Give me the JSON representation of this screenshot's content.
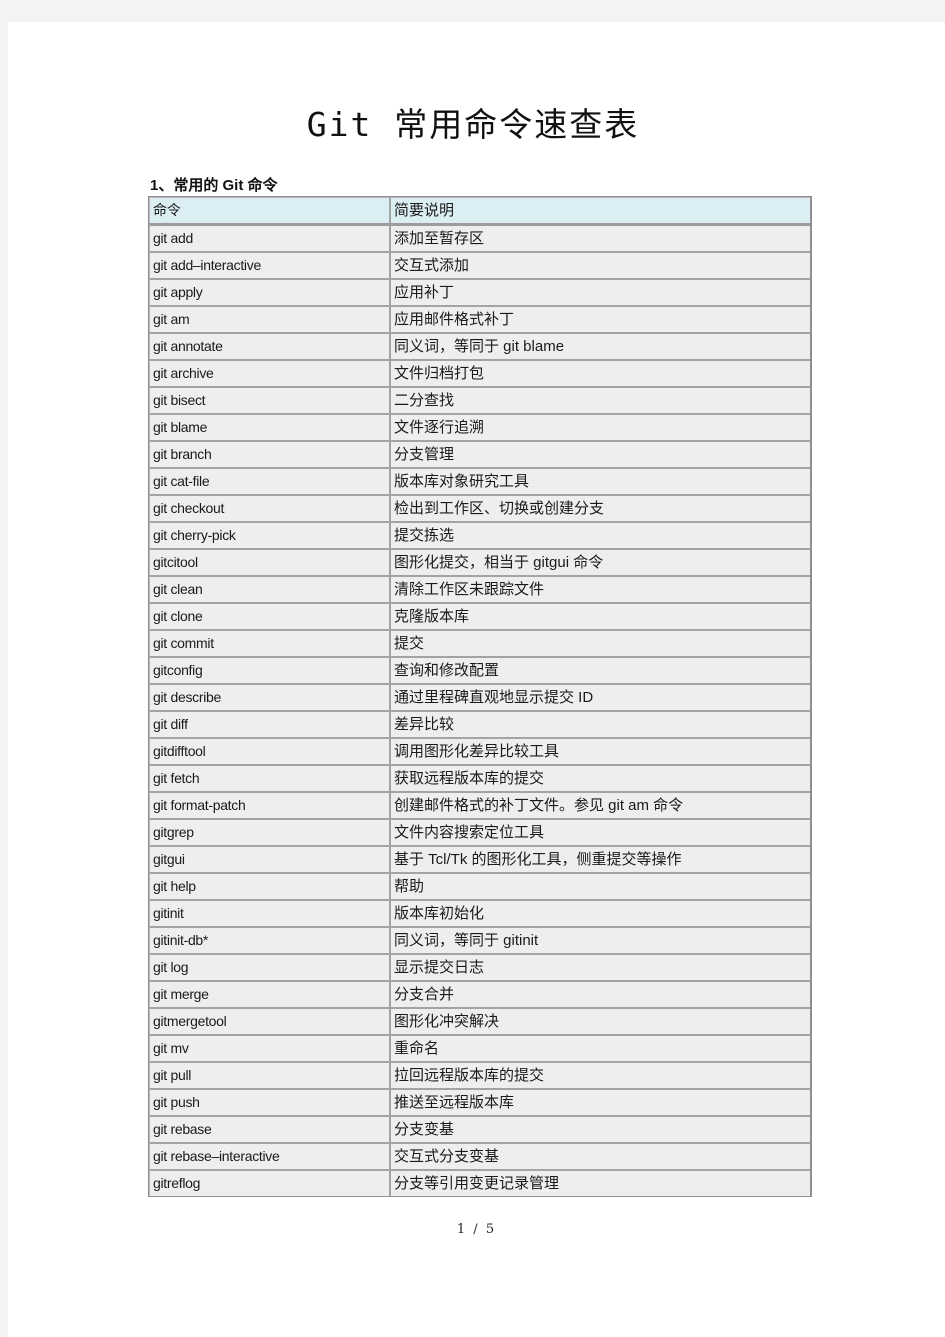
{
  "document": {
    "title": "Git 常用命令速查表",
    "section_heading": "1、常用的 Git 命令",
    "page_number": "1 / 5"
  },
  "colors": {
    "header_bg": "#daeef3",
    "cell_bg": "#eeeeee",
    "border": "#a3a3a3",
    "page_bg": "#ffffff",
    "backdrop": "#f3f3f3"
  },
  "table": {
    "headers": [
      "命令",
      "简要说明"
    ],
    "rows": [
      {
        "cmd": "git  add",
        "desc": "添加至暂存区"
      },
      {
        "cmd": "git  add–interactive",
        "desc": "交互式添加"
      },
      {
        "cmd": "git  apply",
        "desc": "应用补丁"
      },
      {
        "cmd": "git  am",
        "desc": "应用邮件格式补丁"
      },
      {
        "cmd": "git  annotate",
        "desc": "同义词，等同于 git  blame"
      },
      {
        "cmd": "git  archive",
        "desc": "文件归档打包"
      },
      {
        "cmd": "git  bisect",
        "desc": "二分查找"
      },
      {
        "cmd": "git  blame",
        "desc": "文件逐行追溯"
      },
      {
        "cmd": "git  branch",
        "desc": "分支管理"
      },
      {
        "cmd": "git  cat-file",
        "desc": "版本库对象研究工具"
      },
      {
        "cmd": "git  checkout",
        "desc": "检出到工作区、切换或创建分支"
      },
      {
        "cmd": "git  cherry-pick",
        "desc": "提交拣选"
      },
      {
        "cmd": "gitcitool",
        "desc": "图形化提交，相当于 gitgui  命令"
      },
      {
        "cmd": "git  clean",
        "desc": "清除工作区未跟踪文件"
      },
      {
        "cmd": "git  clone",
        "desc": "克隆版本库"
      },
      {
        "cmd": "git  commit",
        "desc": "提交"
      },
      {
        "cmd": "gitconfig",
        "desc": "查询和修改配置"
      },
      {
        "cmd": "git  describe",
        "desc": "通过里程碑直观地显示提交 ID"
      },
      {
        "cmd": "git  diff",
        "desc": "差异比较"
      },
      {
        "cmd": "gitdifftool",
        "desc": "调用图形化差异比较工具"
      },
      {
        "cmd": "git  fetch",
        "desc": "获取远程版本库的提交"
      },
      {
        "cmd": "git  format-patch",
        "desc": "创建邮件格式的补丁文件。参见 git  am  命令"
      },
      {
        "cmd": "gitgrep",
        "desc": "文件内容搜索定位工具"
      },
      {
        "cmd": "gitgui",
        "desc": "基于 Tcl/Tk 的图形化工具，侧重提交等操作"
      },
      {
        "cmd": "git  help",
        "desc": "帮助"
      },
      {
        "cmd": "gitinit",
        "desc": "版本库初始化"
      },
      {
        "cmd": "gitinit-db*",
        "desc": "同义词，等同于 gitinit"
      },
      {
        "cmd": "git  log",
        "desc": "显示提交日志"
      },
      {
        "cmd": "git  merge",
        "desc": "分支合并"
      },
      {
        "cmd": "gitmergetool",
        "desc": "图形化冲突解决"
      },
      {
        "cmd": "git  mv",
        "desc": "重命名"
      },
      {
        "cmd": "git  pull",
        "desc": "拉回远程版本库的提交"
      },
      {
        "cmd": "git  push",
        "desc": "推送至远程版本库"
      },
      {
        "cmd": "git  rebase",
        "desc": "分支变基"
      },
      {
        "cmd": "git  rebase–interactive",
        "desc": "交互式分支变基"
      },
      {
        "cmd": "gitreflog",
        "desc": "分支等引用变更记录管理"
      }
    ]
  }
}
